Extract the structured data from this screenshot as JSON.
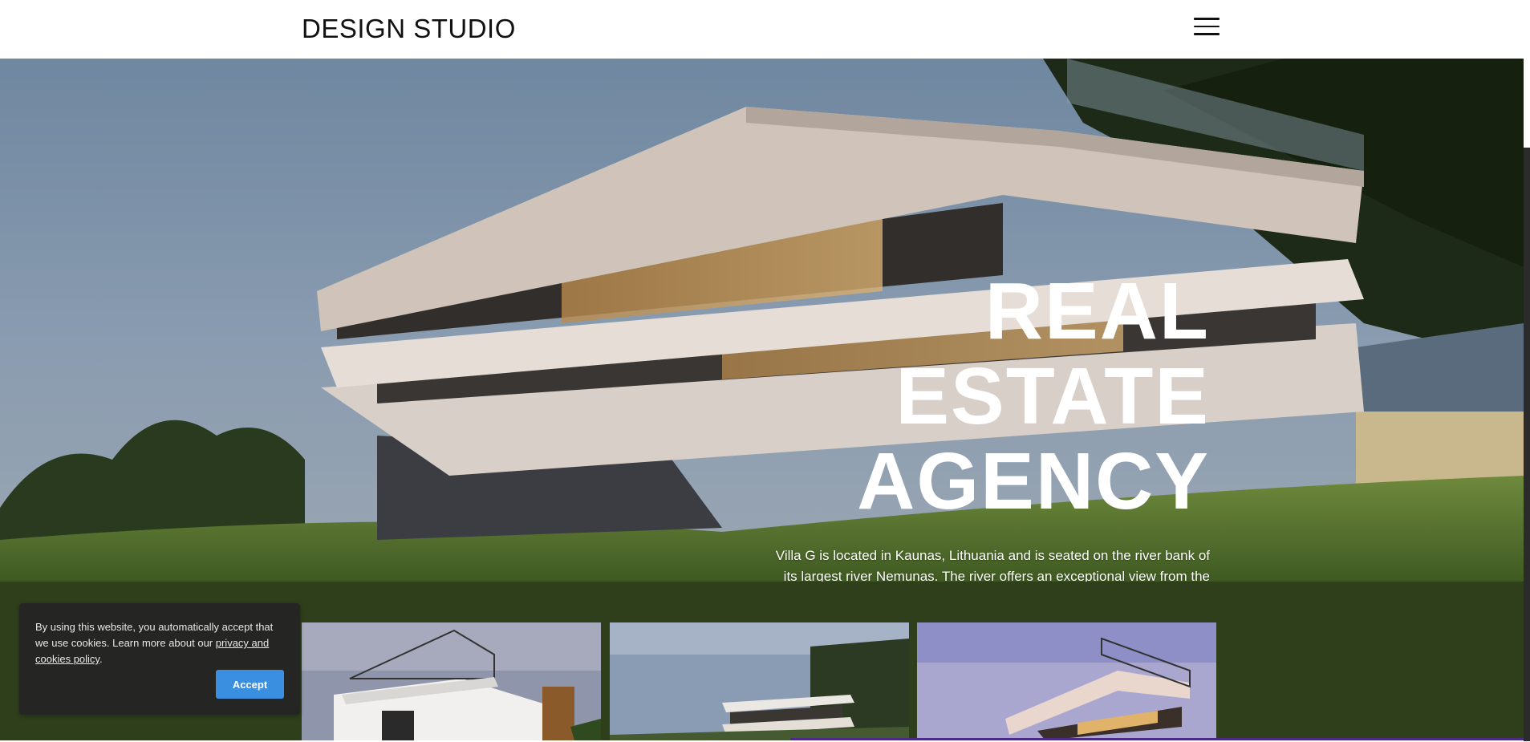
{
  "header": {
    "logo": "DESIGN STUDIO",
    "menu_icon": "hamburger-menu-icon"
  },
  "hero": {
    "headline": [
      "REAL",
      "ESTATE",
      "AGENCY"
    ],
    "description": "Villa G is located in Kaunas, Lithuania and is seated on the river bank of its largest river Nemunas. The river offers an exceptional view from the house, however, it is facing the North side of the site while the street is on the South."
  },
  "gallery": {
    "band_color": "#2f3f1c",
    "items": [
      "villa-photo",
      "villa-photo",
      "villa-photo"
    ]
  },
  "cookie": {
    "text_before": "By using this website, you automatically accept that we use cookies. Learn more about our ",
    "link_text": "privacy and cookies policy",
    "text_after": ".",
    "accept_label": "Accept",
    "accept_color": "#3b8fe0"
  }
}
